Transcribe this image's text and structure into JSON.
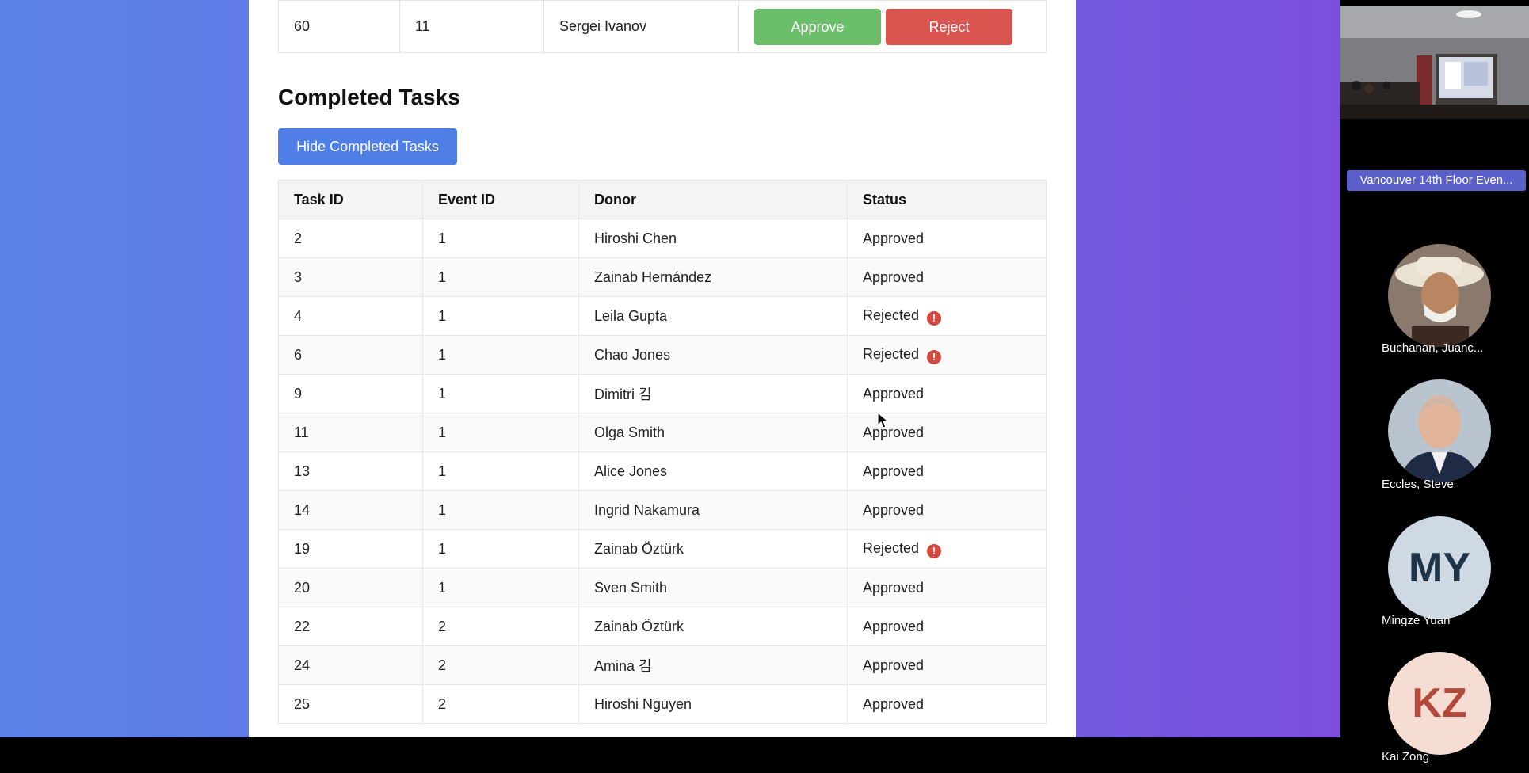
{
  "pending": {
    "row": {
      "task_id": "60",
      "event_id": "11",
      "donor": "Sergei Ivanov"
    },
    "approve_label": "Approve",
    "reject_label": "Reject",
    "colors": {
      "approve": "#6bbf6b",
      "reject": "#d9534f"
    }
  },
  "completed": {
    "title": "Completed Tasks",
    "hide_button_label": "Hide Completed Tasks",
    "columns": [
      "Task ID",
      "Event ID",
      "Donor",
      "Status"
    ],
    "rows": [
      {
        "task_id": "2",
        "event_id": "1",
        "donor": "Hiroshi Chen",
        "status": "Approved"
      },
      {
        "task_id": "3",
        "event_id": "1",
        "donor": "Zainab Hernández",
        "status": "Approved"
      },
      {
        "task_id": "4",
        "event_id": "1",
        "donor": "Leila Gupta",
        "status": "Rejected"
      },
      {
        "task_id": "6",
        "event_id": "1",
        "donor": "Chao Jones",
        "status": "Rejected"
      },
      {
        "task_id": "9",
        "event_id": "1",
        "donor": "Dimitri 김",
        "status": "Approved"
      },
      {
        "task_id": "11",
        "event_id": "1",
        "donor": "Olga Smith",
        "status": "Approved"
      },
      {
        "task_id": "13",
        "event_id": "1",
        "donor": "Alice Jones",
        "status": "Approved"
      },
      {
        "task_id": "14",
        "event_id": "1",
        "donor": "Ingrid Nakamura",
        "status": "Approved"
      },
      {
        "task_id": "19",
        "event_id": "1",
        "donor": "Zainab Öztürk",
        "status": "Rejected"
      },
      {
        "task_id": "20",
        "event_id": "1",
        "donor": "Sven Smith",
        "status": "Approved"
      },
      {
        "task_id": "22",
        "event_id": "2",
        "donor": "Zainab Öztürk",
        "status": "Approved"
      },
      {
        "task_id": "24",
        "event_id": "2",
        "donor": "Amina 김",
        "status": "Approved"
      },
      {
        "task_id": "25",
        "event_id": "2",
        "donor": "Hiroshi Nguyen",
        "status": "Approved"
      }
    ],
    "rejected_icon": "exclamation-circle-icon",
    "rejected_icon_glyph": "!",
    "rejected_color": "#d04a3f"
  },
  "meeting": {
    "room_label": "Vancouver 14th Floor Even...",
    "participants": [
      {
        "name": "Buchanan, Juanc...",
        "avatar": "photo-avatar"
      },
      {
        "name": "Eccles, Steve",
        "avatar": "photo-avatar"
      },
      {
        "name": "Mingze Yuan",
        "initials": "MY",
        "bg": "#cfd9e3",
        "fg": "#1e3346"
      },
      {
        "name": "Kai Zong",
        "initials": "KZ",
        "bg": "#f6ddd3",
        "fg": "#b2493a"
      }
    ]
  }
}
